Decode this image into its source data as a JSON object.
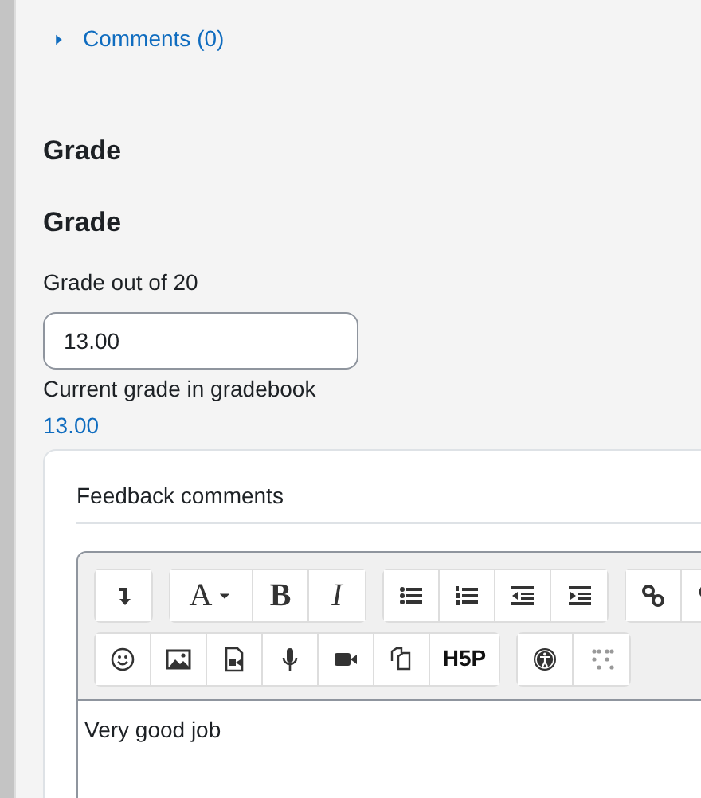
{
  "comments": {
    "label": "Comments (0)",
    "expanded": false
  },
  "section_heading": "Grade",
  "grade_heading": "Grade",
  "grade_field": {
    "label": "Grade out of 20",
    "value": "13.00"
  },
  "gradebook": {
    "label": "Current grade in gradebook",
    "value": "13.00"
  },
  "feedback": {
    "title": "Feedback comments",
    "toolbar_rows": [
      [
        [
          {
            "kind": "icon"
          }
        ],
        [
          {
            "kind": "dropdown",
            "label": "A"
          },
          {
            "kind": "bold",
            "label": "B"
          },
          {
            "kind": "italic",
            "label": "I"
          }
        ],
        [
          {
            "kind": "icon"
          },
          {
            "kind": "icon"
          },
          {
            "kind": "icon"
          },
          {
            "kind": "icon"
          }
        ],
        [
          {
            "kind": "icon"
          },
          {
            "kind": "icon"
          }
        ]
      ],
      [
        [
          {
            "kind": "icon"
          },
          {
            "kind": "icon"
          },
          {
            "kind": "icon"
          },
          {
            "kind": "icon"
          },
          {
            "kind": "icon"
          },
          {
            "kind": "icon"
          },
          {
            "kind": "bold",
            "label": "H5P"
          }
        ],
        [
          {
            "kind": "icon"
          },
          {
            "kind": "icon"
          }
        ]
      ]
    ],
    "content": "Very good job"
  }
}
